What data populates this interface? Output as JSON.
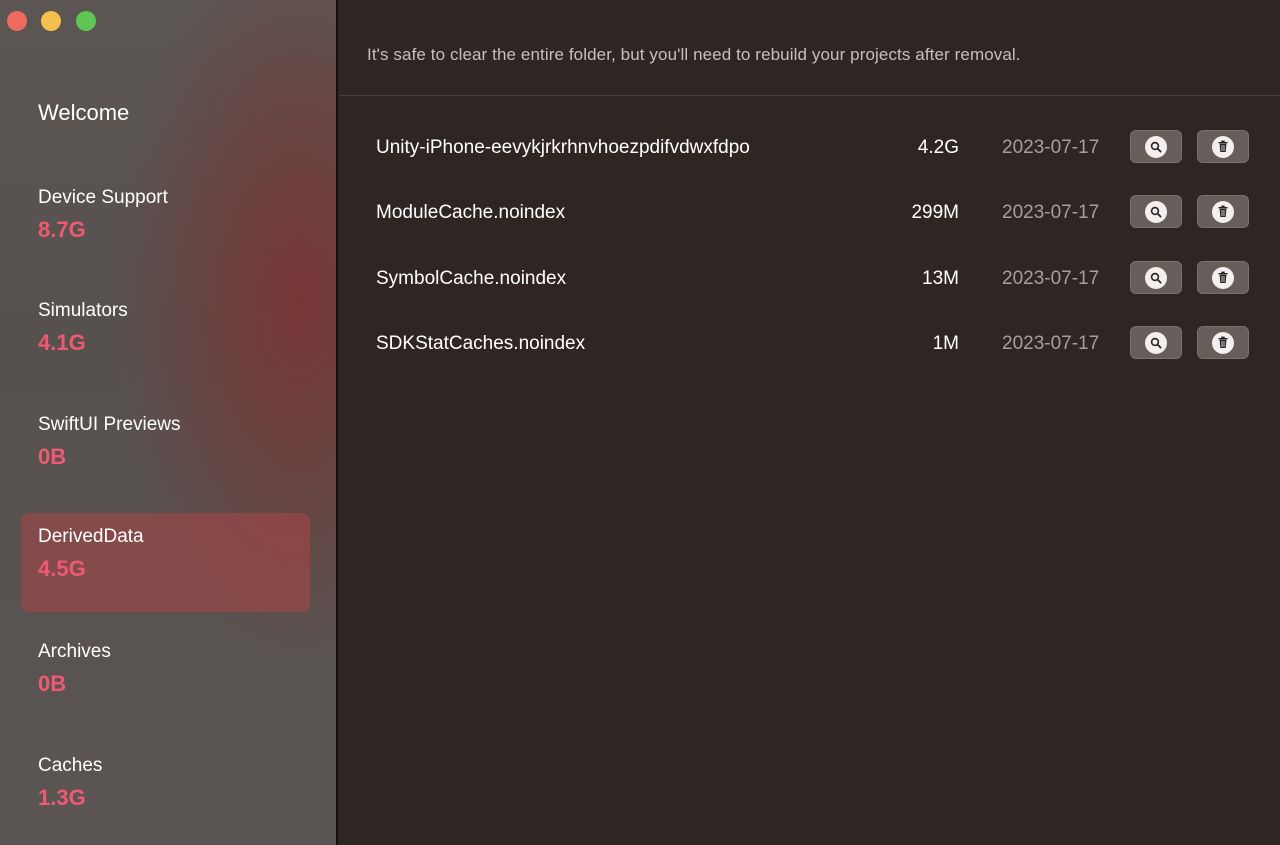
{
  "window": {
    "controls": [
      "close",
      "minimize",
      "zoom"
    ]
  },
  "sidebar": {
    "welcome_label": "Welcome",
    "selected": "DerivedData",
    "items": [
      {
        "label": "Device Support",
        "size": "8.7G"
      },
      {
        "label": "Simulators",
        "size": "4.1G"
      },
      {
        "label": "SwiftUI Previews",
        "size": "0B"
      },
      {
        "label": "DerivedData",
        "size": "4.5G"
      },
      {
        "label": "Archives",
        "size": "0B"
      },
      {
        "label": "Caches",
        "size": "1.3G"
      }
    ]
  },
  "main": {
    "notice": "It's safe to clear the entire folder, but you'll need to rebuild your projects after removal.",
    "rows": [
      {
        "name": "Unity-iPhone-eevykjrkrhnvhoezpdifvdwxfdpo",
        "size": "4.2G",
        "date": "2023-07-17"
      },
      {
        "name": "ModuleCache.noindex",
        "size": "299M",
        "date": "2023-07-17"
      },
      {
        "name": "SymbolCache.noindex",
        "size": "13M",
        "date": "2023-07-17"
      },
      {
        "name": "SDKStatCaches.noindex",
        "size": "1M",
        "date": "2023-07-17"
      }
    ],
    "row_actions": {
      "reveal_icon": "magnifier-icon",
      "delete_icon": "trash-icon"
    }
  },
  "colors": {
    "accent_size": "#ee5a73",
    "main_background": "#2f2522",
    "selection": "#a84646"
  }
}
